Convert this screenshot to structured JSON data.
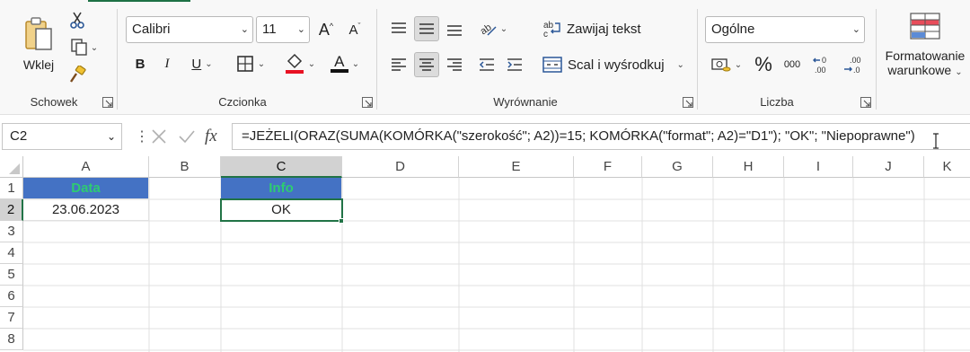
{
  "ribbon": {
    "clipboard": {
      "paste_label": "Wklej",
      "group_label": "Schowek"
    },
    "font": {
      "font_name": "Calibri",
      "font_size": "11",
      "bold": "B",
      "italic": "I",
      "underline": "U",
      "font_color_letter": "A",
      "group_label": "Czcionka"
    },
    "alignment": {
      "wrap_text": "Zawijaj tekst",
      "merge_center": "Scal i wyśrodkuj",
      "group_label": "Wyrównanie"
    },
    "number": {
      "format": "Ogólne",
      "percent": "%",
      "thousands": "000",
      "group_label": "Liczba"
    },
    "styles": {
      "conditional_line1": "Formatowanie",
      "conditional_line2": "warunkowe"
    }
  },
  "formula_bar": {
    "name_box": "C2",
    "fx": "fx",
    "formula": "=JEŻELI(ORAZ(SUMA(KOMÓRKA(\"szerokość\"; A2))=15; KOMÓRKA(\"format\"; A2)=\"D1\"); \"OK\"; \"Niepoprawne\")"
  },
  "sheet": {
    "columns": [
      "A",
      "B",
      "C",
      "D",
      "E",
      "F",
      "G",
      "H",
      "I",
      "J",
      "K"
    ],
    "rows": [
      "1",
      "2",
      "3",
      "4",
      "5",
      "6",
      "7",
      "8"
    ],
    "cells": {
      "A1": "Data",
      "C1": "Info",
      "A2": "23.06.2023",
      "C2": "OK"
    }
  },
  "colors": {
    "header_fill": "#4472C4",
    "header_text": "#2ECC71",
    "excel_green": "#217346",
    "font_color_bar": "#C00000",
    "fill_color_bar": "#E81123"
  }
}
